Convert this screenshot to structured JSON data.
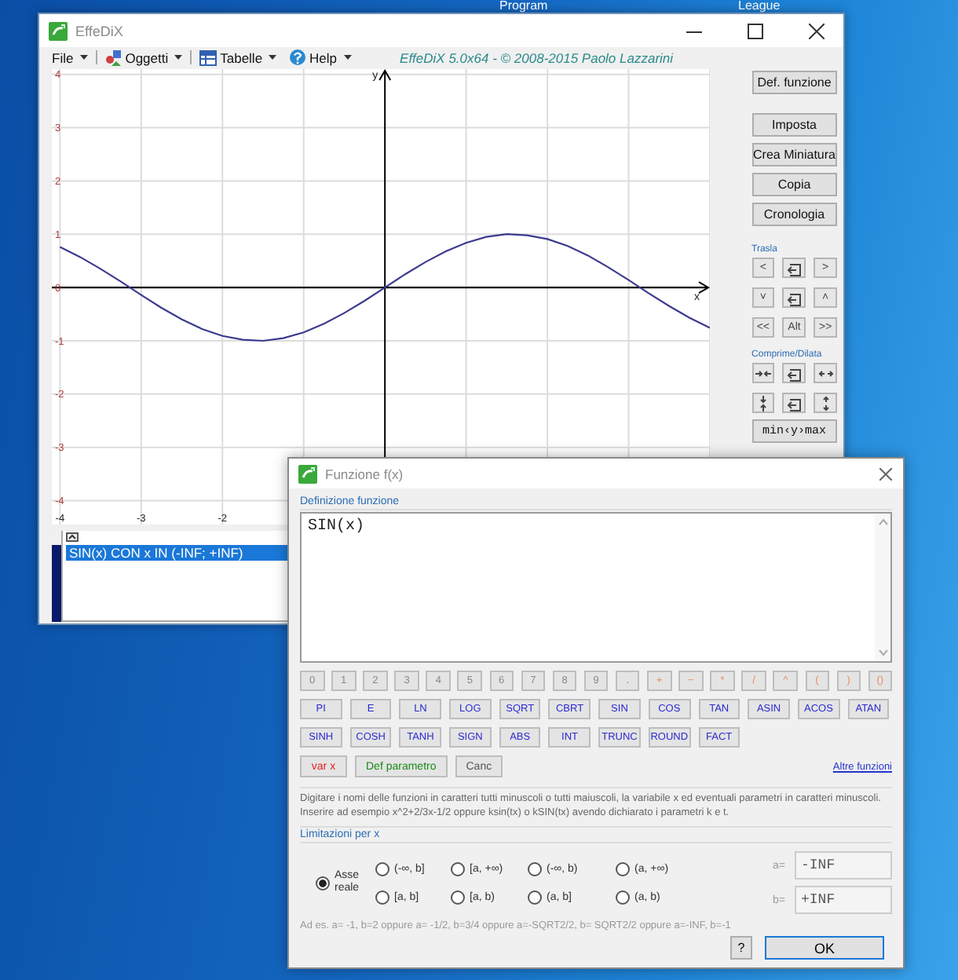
{
  "desktop": {
    "icon_labels": [
      "Program",
      "League"
    ]
  },
  "main_window": {
    "title": "EffeDiX",
    "menu": [
      {
        "label": "File",
        "kind": "plain"
      },
      {
        "label": "Oggetti",
        "kind": "objects"
      },
      {
        "label": "Tabelle",
        "kind": "table"
      },
      {
        "label": "Help",
        "kind": "help"
      }
    ],
    "caption": "EffeDiX 5.0x64 - © 2008-2015 Paolo Lazzarini",
    "graph": {
      "chart_data": {
        "type": "line",
        "xlabel": "x",
        "ylabel": "y",
        "x": [
          -4,
          -3.75,
          -3.5,
          -3.25,
          -3,
          -2.75,
          -2.5,
          -2.25,
          -2,
          -1.75,
          -1.5,
          -1.25,
          -1,
          -0.75,
          -0.5,
          -0.25,
          0,
          0.25,
          0.5,
          0.75,
          1,
          1.25,
          1.5,
          1.75,
          2,
          2.25,
          2.5,
          2.75,
          3,
          3.25,
          3.5,
          3.75,
          4
        ],
        "series": [
          {
            "color": "#3b3b8f",
            "values": [
              0.76,
              0.57,
              0.35,
              0.11,
              -0.14,
              -0.38,
              -0.6,
              -0.78,
              -0.91,
              -0.98,
              -1,
              -0.95,
              -0.84,
              -0.68,
              -0.48,
              -0.25,
              0,
              0.25,
              0.48,
              0.68,
              0.84,
              0.95,
              1,
              0.98,
              0.91,
              0.78,
              0.6,
              0.38,
              0.14,
              -0.11,
              -0.35,
              -0.57,
              -0.76
            ]
          }
        ],
        "xlim": [
          -4.1,
          4.0
        ],
        "ylim": [
          -4.45,
          4.1
        ],
        "grid": true,
        "xticks": [
          -4,
          -3,
          -2
        ],
        "yticks": [
          4,
          3,
          2,
          1,
          0,
          -1,
          -2,
          -3,
          -4
        ]
      }
    },
    "function_list": [
      {
        "text": "SIN(x) CON x IN (-INF; +INF)",
        "selected": true
      }
    ],
    "side_panel": {
      "main_button": "Def. funzione",
      "buttons": [
        "Imposta",
        "Crea Miniatura",
        "Copia",
        "Cronologia"
      ],
      "groups": [
        {
          "title": "Trasla",
          "keys": [
            {
              "kind": "text",
              "label": "<"
            },
            {
              "kind": "reset"
            },
            {
              "kind": "text",
              "label": ">"
            },
            {
              "kind": "text",
              "label": "˅"
            },
            {
              "kind": "reset"
            },
            {
              "kind": "text",
              "label": "˄"
            },
            {
              "kind": "text",
              "label": "<<"
            },
            {
              "kind": "text",
              "label": "Alt"
            },
            {
              "kind": "text",
              "label": ">>"
            }
          ]
        },
        {
          "title": "Comprime/Dilata",
          "keys": [
            {
              "kind": "shrink-x"
            },
            {
              "kind": "reset"
            },
            {
              "kind": "grow-x"
            },
            {
              "kind": "shrink-y"
            },
            {
              "kind": "reset"
            },
            {
              "kind": "grow-y"
            }
          ]
        }
      ],
      "range_button": "min‹y›max"
    }
  },
  "dialog": {
    "title": "Funzione f(x)",
    "definition": {
      "label": "Definizione funzione",
      "value": "SIN(x)"
    },
    "keypad": [
      [
        {
          "kind": "digit",
          "label": "0"
        },
        {
          "kind": "digit",
          "label": "1"
        },
        {
          "kind": "digit",
          "label": "2"
        },
        {
          "kind": "digit",
          "label": "3"
        },
        {
          "kind": "digit",
          "label": "4"
        },
        {
          "kind": "digit",
          "label": "5"
        },
        {
          "kind": "digit",
          "label": "6"
        },
        {
          "kind": "digit",
          "label": "7"
        },
        {
          "kind": "digit",
          "label": "8"
        },
        {
          "kind": "digit",
          "label": "9"
        },
        {
          "kind": "digit",
          "label": "."
        },
        {
          "kind": "operator",
          "label": "+"
        },
        {
          "kind": "operator",
          "label": "−"
        },
        {
          "kind": "operator",
          "label": "*"
        },
        {
          "kind": "operator",
          "label": "/"
        },
        {
          "kind": "operator",
          "label": "^"
        },
        {
          "kind": "operator",
          "label": "("
        },
        {
          "kind": "operator",
          "label": ")"
        },
        {
          "kind": "operator",
          "label": "()"
        }
      ],
      [
        {
          "kind": "function",
          "label": "PI"
        },
        {
          "kind": "function",
          "label": "E"
        },
        {
          "kind": "function",
          "label": "LN"
        },
        {
          "kind": "function",
          "label": "LOG"
        },
        {
          "kind": "function",
          "label": "SQRT"
        },
        {
          "kind": "function",
          "label": "CBRT"
        },
        {
          "kind": "function",
          "label": "SIN"
        },
        {
          "kind": "function",
          "label": "COS"
        },
        {
          "kind": "function",
          "label": "TAN"
        },
        {
          "kind": "function",
          "label": "ASIN"
        },
        {
          "kind": "function",
          "label": "ACOS"
        },
        {
          "kind": "function",
          "label": "ATAN"
        }
      ],
      [
        {
          "kind": "function",
          "label": "SINH"
        },
        {
          "kind": "function",
          "label": "COSH"
        },
        {
          "kind": "function",
          "label": "TANH"
        },
        {
          "kind": "function",
          "label": "SIGN"
        },
        {
          "kind": "function",
          "label": "ABS"
        },
        {
          "kind": "function",
          "label": "INT"
        },
        {
          "kind": "function",
          "label": "TRUNC"
        },
        {
          "kind": "function",
          "label": "ROUND"
        },
        {
          "kind": "function",
          "label": "FACT"
        }
      ]
    ],
    "actions": [
      {
        "kind": "variable",
        "label": "var x"
      },
      {
        "kind": "parameter",
        "label": "Def parametro"
      },
      {
        "kind": "clear",
        "label": "Canc"
      }
    ],
    "more_link": "Altre funzioni",
    "hint": "Digitare i nomi delle funzioni in caratteri tutti minuscoli o tutti maiuscoli, la variabile x ed eventuali parametri in caratteri minuscoli. Inserire ad esempio x^2+2/3x-1/2 oppure ksin(tx) o kSIN(tx) avendo dichiarato i parametri k e t.",
    "limits": {
      "label": "Limitazioni per x",
      "axis_option": {
        "label": "Asse reale",
        "selected": true
      },
      "options": [
        {
          "label": "(-∞, b]",
          "selected": false
        },
        {
          "label": "[a, +∞)",
          "selected": false
        },
        {
          "label": "(-∞, b)",
          "selected": false
        },
        {
          "label": "(a, +∞)",
          "selected": false
        },
        {
          "label": "[a, b]",
          "selected": false
        },
        {
          "label": "[a, b)",
          "selected": false
        },
        {
          "label": "(a, b]",
          "selected": false
        },
        {
          "label": "(a, b)",
          "selected": false
        }
      ],
      "fields": [
        {
          "label": "a=",
          "value": "-INF",
          "disabled": true
        },
        {
          "label": "b=",
          "value": "+INF",
          "disabled": true
        }
      ],
      "example": "Ad es. a= -1, b=2 oppure a= -1/2, b=3/4 oppure a=-SQRT2/2, b= SQRT2/2 oppure a=-INF, b=-1"
    },
    "buttons": [
      {
        "kind": "help",
        "label": "?"
      },
      {
        "kind": "ok",
        "label": "OK"
      }
    ]
  }
}
